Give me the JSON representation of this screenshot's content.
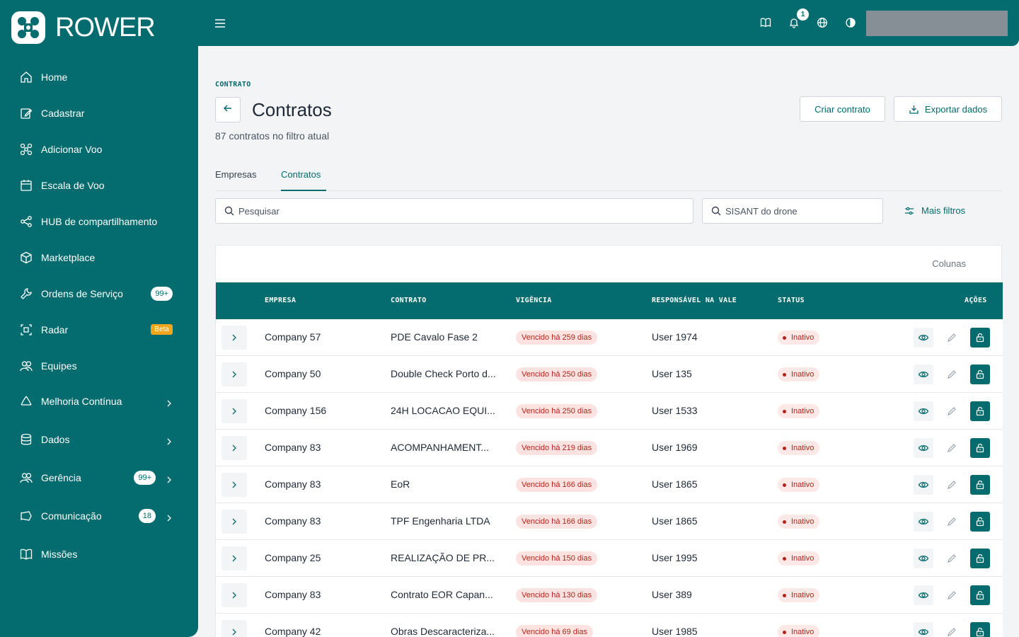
{
  "app": {
    "logo_text": "ROWER"
  },
  "sidebar": {
    "items": [
      {
        "label": "Home",
        "icon": "home-icon"
      },
      {
        "label": "Cadastrar",
        "icon": "edit-icon"
      },
      {
        "label": "Adicionar Voo",
        "icon": "drone-icon"
      },
      {
        "label": "Escala de Voo",
        "icon": "calendar-icon"
      },
      {
        "label": "HUB de compartilhamento",
        "icon": "share-icon"
      },
      {
        "label": "Marketplace",
        "icon": "box-icon"
      },
      {
        "label": "Ordens de Serviço",
        "icon": "wrench-icon",
        "badge": "99+"
      },
      {
        "label": "Radar",
        "icon": "radar-icon",
        "beta": "Beta"
      },
      {
        "label": "Equipes",
        "icon": "users-icon"
      },
      {
        "label": "Melhoria Contínua",
        "icon": "recycle-icon"
      },
      {
        "label": "Dados",
        "icon": "database-icon"
      },
      {
        "label": "Gerência",
        "icon": "team-icon",
        "badge": "99+"
      },
      {
        "label": "Comunicação",
        "icon": "megaphone-icon",
        "badge": "18"
      },
      {
        "label": "Missões",
        "icon": "book-icon"
      }
    ]
  },
  "topbar": {
    "notification_count": "1"
  },
  "header": {
    "eyebrow": "CONTRATO",
    "title": "Contratos",
    "subtitle": "87 contratos no filtro atual",
    "create_label": "Criar contrato",
    "export_label": "Exportar dados"
  },
  "tabs": [
    {
      "label": "Empresas"
    },
    {
      "label": "Contratos"
    }
  ],
  "filters": {
    "search_placeholder": "Pesquisar",
    "sisant_placeholder": "SISANT do drone",
    "more_filters_label": "Mais filtros"
  },
  "table": {
    "columns_label": "Colunas",
    "headers": {
      "empresa": "EMPRESA",
      "contrato": "CONTRATO",
      "vigencia": "VIGÊNCIA",
      "responsavel": "RESPONSÁVEL NA VALE",
      "status": "STATUS",
      "acoes": "AÇÕES"
    },
    "rows": [
      {
        "empresa": "Company 57",
        "contrato": "PDE Cavalo Fase 2",
        "vigencia": "Vencido há 259 dias",
        "responsavel": "User 1974",
        "status": "Inativo"
      },
      {
        "empresa": "Company 50",
        "contrato": "Double Check Porto d...",
        "vigencia": "Vencido há 250 dias",
        "responsavel": "User 135",
        "status": "Inativo"
      },
      {
        "empresa": "Company 156",
        "contrato": "24H LOCACAO EQUI...",
        "vigencia": "Vencido há 250 dias",
        "responsavel": "User 1533",
        "status": "Inativo"
      },
      {
        "empresa": "Company 83",
        "contrato": "ACOMPANHAMENT...",
        "vigencia": "Vencido há 219 dias",
        "responsavel": "User 1969",
        "status": "Inativo"
      },
      {
        "empresa": "Company 83",
        "contrato": "EoR",
        "vigencia": "Vencido há 166 dias",
        "responsavel": "User 1865",
        "status": "Inativo"
      },
      {
        "empresa": "Company 83",
        "contrato": "TPF Engenharia LTDA",
        "vigencia": "Vencido há 166 dias",
        "responsavel": "User 1865",
        "status": "Inativo"
      },
      {
        "empresa": "Company 25",
        "contrato": "REALIZAÇÃO DE PR...",
        "vigencia": "Vencido há 150 dias",
        "responsavel": "User 1995",
        "status": "Inativo"
      },
      {
        "empresa": "Company 83",
        "contrato": "Contrato EOR Capan...",
        "vigencia": "Vencido há 130 dias",
        "responsavel": "User 389",
        "status": "Inativo"
      },
      {
        "empresa": "Company 42",
        "contrato": "Obras Descaracteriza...",
        "vigencia": "Vencido há 69 dias",
        "responsavel": "User 1985",
        "status": "Inativo"
      }
    ]
  },
  "colors": {
    "brand": "#046b6e",
    "danger": "#b42318",
    "beta": "#f3a51b"
  }
}
